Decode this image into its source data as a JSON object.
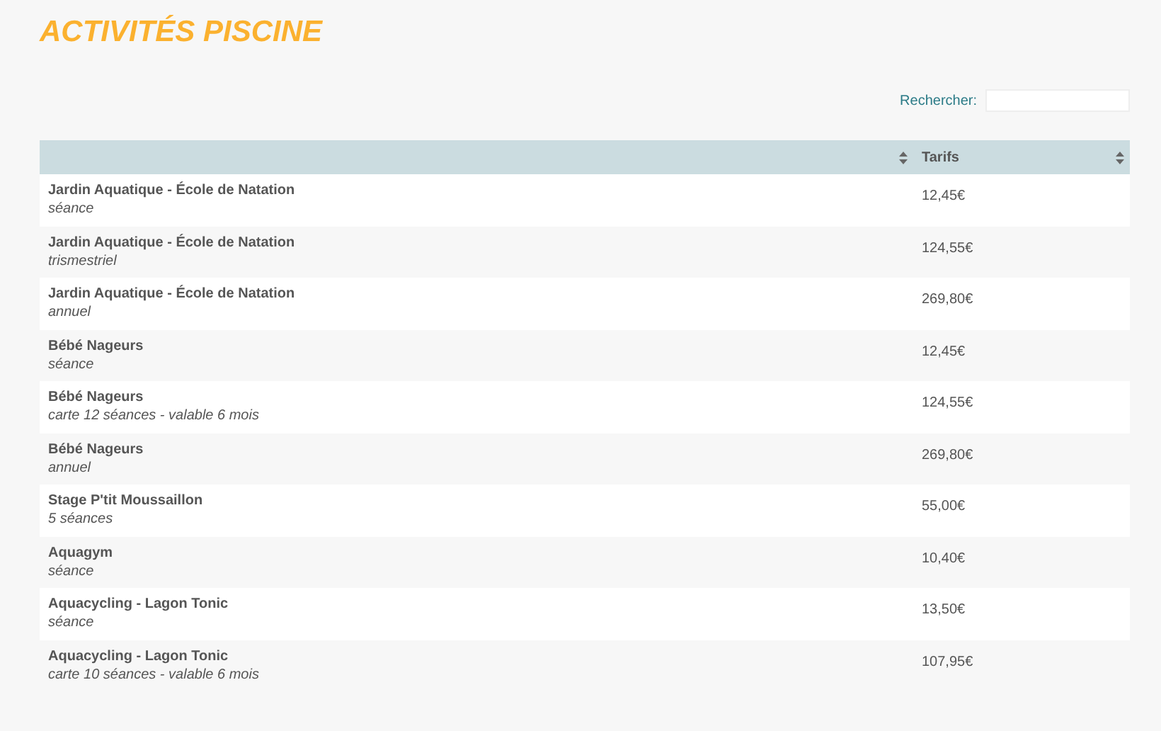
{
  "title": "ACTIVITÉS PISCINE",
  "search": {
    "label": "Rechercher:"
  },
  "table": {
    "columns": [
      {
        "sortable": true
      },
      {
        "label": "Tarifs",
        "sortable": true
      }
    ],
    "rows": [
      {
        "name": "Jardin Aquatique - École de Natation",
        "detail": "séance",
        "price": "12,45€"
      },
      {
        "name": "Jardin Aquatique - École de Natation",
        "detail": "trismestriel",
        "price": "124,55€"
      },
      {
        "name": "Jardin Aquatique - École de Natation",
        "detail": "annuel",
        "price": "269,80€"
      },
      {
        "name": "Bébé Nageurs",
        "detail": "séance",
        "price": "12,45€"
      },
      {
        "name": "Bébé Nageurs",
        "detail": "carte 12 séances - valable 6 mois",
        "price": "124,55€"
      },
      {
        "name": "Bébé Nageurs",
        "detail": "annuel",
        "price": "269,80€"
      },
      {
        "name": "Stage P'tit Moussaillon",
        "detail": "5 séances",
        "price": "55,00€"
      },
      {
        "name": "Aquagym",
        "detail": "séance",
        "price": "10,40€"
      },
      {
        "name": "Aquacycling - Lagon Tonic",
        "detail": "séance",
        "price": "13,50€"
      },
      {
        "name": "Aquacycling - Lagon Tonic",
        "detail": "carte 10 séances - valable 6 mois",
        "price": "107,95€"
      }
    ]
  }
}
